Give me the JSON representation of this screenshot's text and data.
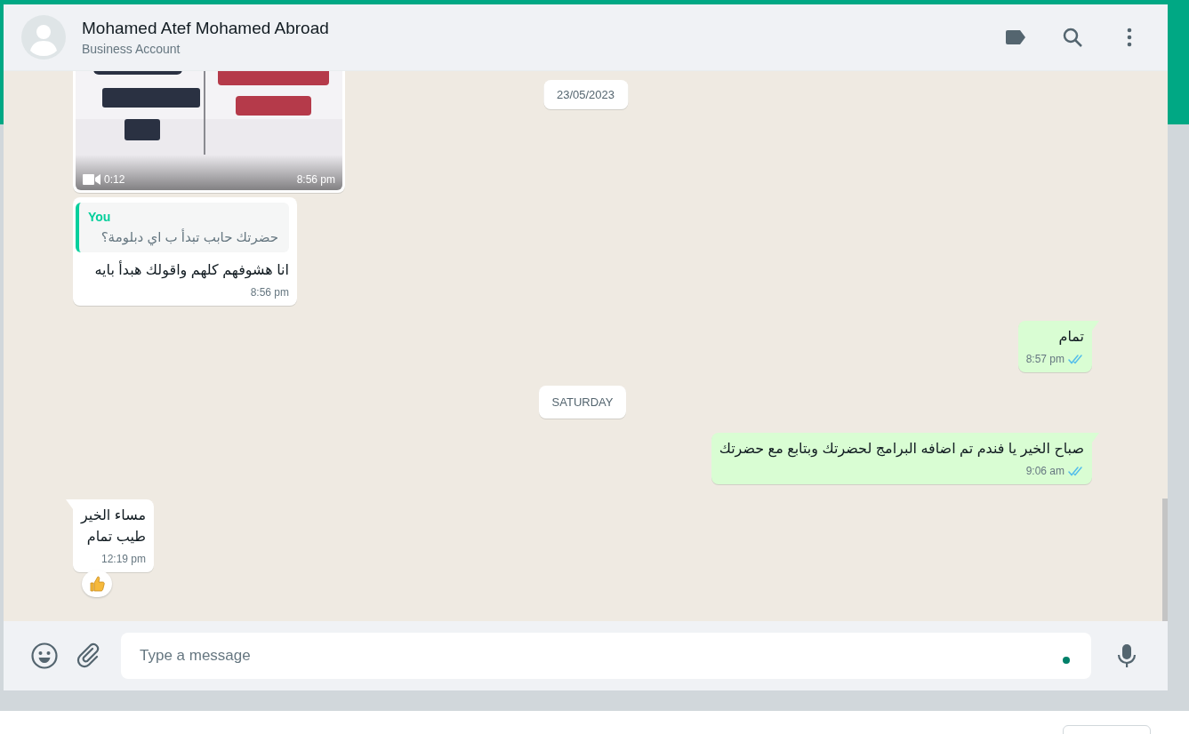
{
  "header": {
    "name": "Mohamed Atef Mohamed Abroad",
    "subtitle": "Business Account"
  },
  "sticky_date": "23/05/2023",
  "messages": [
    {
      "kind": "video",
      "outgoing": false,
      "tail": false,
      "duration": "0:12",
      "time": "8:56 pm"
    },
    {
      "kind": "text",
      "outgoing": false,
      "tail": false,
      "quote": {
        "author": "You",
        "text": "حضرتك حابب تبدأ ب اي دبلومة؟"
      },
      "text": "انا هشوفهم كلهم واقولك هبدأ بايه",
      "time": "8:56 pm"
    },
    {
      "kind": "text",
      "outgoing": true,
      "tail": true,
      "text": "تمام",
      "time": "8:57 pm",
      "read": true
    },
    {
      "kind": "date",
      "text": "SATURDAY"
    },
    {
      "kind": "text",
      "outgoing": true,
      "tail": true,
      "text": "صباح الخير يا فندم تم اضافه البرامج لحضرتك وبتابع مع حضرتك",
      "time": "9:06 am",
      "read": true
    },
    {
      "kind": "text",
      "outgoing": false,
      "tail": true,
      "text": "مساء الخير\nطيب تمام",
      "time": "12:19 pm",
      "reacted": true
    }
  ],
  "composer": {
    "placeholder": "Type a message"
  }
}
